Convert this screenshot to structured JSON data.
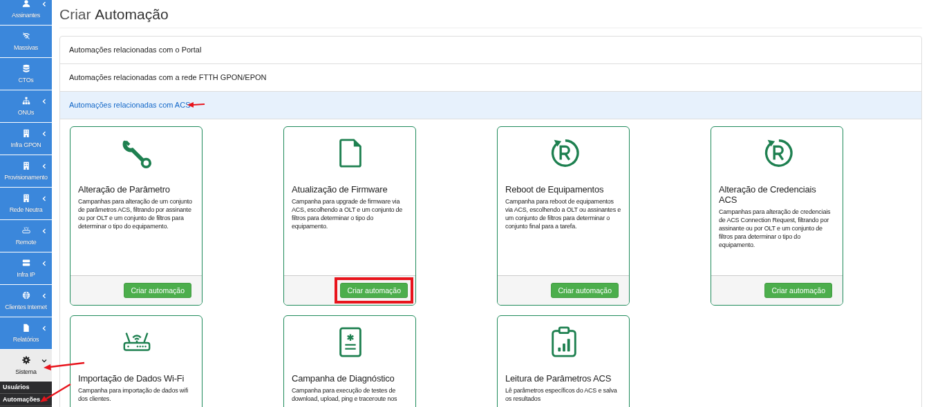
{
  "sidebar": {
    "items": [
      {
        "label": "Assinantes",
        "has_submenu": true,
        "expanded": false
      },
      {
        "label": "Massivas",
        "has_submenu": false,
        "expanded": false
      },
      {
        "label": "CTOs",
        "has_submenu": false,
        "expanded": false
      },
      {
        "label": "ONUs",
        "has_submenu": true,
        "expanded": false
      },
      {
        "label": "Infra GPON",
        "has_submenu": true,
        "expanded": false
      },
      {
        "label": "Provisionamento",
        "has_submenu": true,
        "expanded": false
      },
      {
        "label": "Rede Neutra",
        "has_submenu": true,
        "expanded": false
      },
      {
        "label": "Remote",
        "has_submenu": true,
        "expanded": false
      },
      {
        "label": "Infra IP",
        "has_submenu": true,
        "expanded": false
      },
      {
        "label": "Clientes Internet",
        "has_submenu": true,
        "expanded": false
      },
      {
        "label": "Relatórios",
        "has_submenu": true,
        "expanded": false
      },
      {
        "label": "Sistema",
        "has_submenu": true,
        "expanded": true,
        "children": [
          "Usuários",
          "Automações"
        ]
      }
    ]
  },
  "page_title": "Criar **Automação**",
  "sections": [
    {
      "label": "Automações relacionadas com o Portal",
      "selected": false
    },
    {
      "label": "Automações relacionadas com a rede FTTH GPON/EPON",
      "selected": false
    },
    {
      "label": "Automações relacionadas com ACS",
      "selected": true
    }
  ],
  "cards": [
    {
      "title": "Alteração de Parâmetro",
      "description": "Campanhas para alteração de um conjunto de parâmetros ACS, filtrando por assinante ou por OLT e um conjunto de filtros para determinar o tipo do equipamento.",
      "button": "Criar automação",
      "highlighted": false
    },
    {
      "title": "Atualização de Firmware",
      "description": "Campanha para upgrade de firmware via ACS, escolhendo a OLT e um conjunto de filtros para determinar o tipo do equipamento.",
      "button": "Criar automação",
      "highlighted": true
    },
    {
      "title": "Reboot de Equipamentos",
      "description": "Campanha para reboot de equipamentos via ACS, escolhendo a OLT ou assinantes e um conjunto de filtros para determinar o conjunto final para a tarefa.",
      "button": "Criar automação",
      "highlighted": false
    },
    {
      "title": "Alteração de Credenciais ACS",
      "description": "Campanhas para alteração de credenciais de ACS Connection Request, filtrando por assinante ou por OLT e um conjunto de filtros para determinar o tipo do equipamento.",
      "button": "Criar automação",
      "highlighted": false
    },
    {
      "title": "Importação de Dados Wi-Fi",
      "description": "Campanha para importação de dados wifi dos clientes."
    },
    {
      "title": "Campanha de Diagnóstico",
      "description": "Campanha para execução de testes de download, upload, ping e traceroute nos"
    },
    {
      "title": "Leitura de Parâmetros ACS",
      "description": "Lê parâmetros específicos do ACS e salva os resultados"
    }
  ]
}
